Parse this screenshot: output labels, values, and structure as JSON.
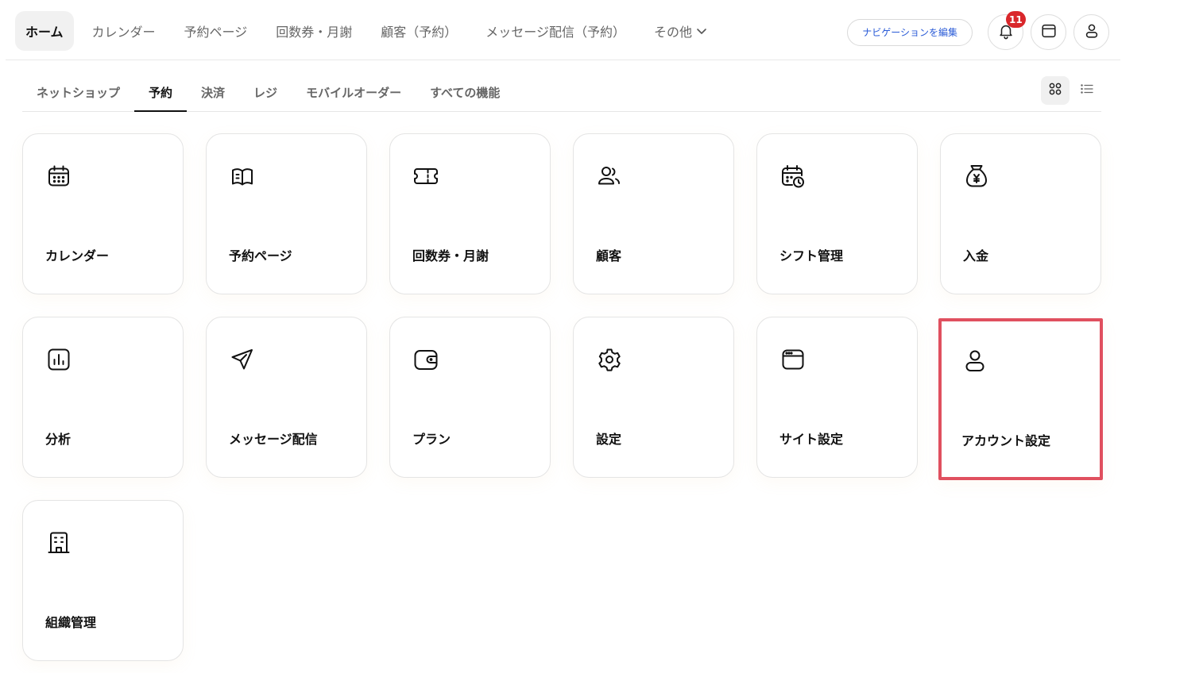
{
  "top_nav": {
    "items": [
      {
        "label": "ホーム"
      },
      {
        "label": "カレンダー"
      },
      {
        "label": "予約ページ"
      },
      {
        "label": "回数券・月謝"
      },
      {
        "label": "顧客（予約）"
      },
      {
        "label": "メッセージ配信（予約）"
      },
      {
        "label": "その他"
      }
    ],
    "edit_nav_label": "ナビゲーションを編集",
    "notification_count": "11"
  },
  "sub_nav": {
    "tabs": [
      {
        "label": "ネットショップ"
      },
      {
        "label": "予約"
      },
      {
        "label": "決済"
      },
      {
        "label": "レジ"
      },
      {
        "label": "モバイルオーダー"
      },
      {
        "label": "すべての機能"
      }
    ]
  },
  "tiles": [
    {
      "label": "カレンダー",
      "icon": "calendar-icon"
    },
    {
      "label": "予約ページ",
      "icon": "open-book-icon"
    },
    {
      "label": "回数券・月謝",
      "icon": "ticket-icon"
    },
    {
      "label": "顧客",
      "icon": "users-icon"
    },
    {
      "label": "シフト管理",
      "icon": "calendar-clock-icon"
    },
    {
      "label": "入金",
      "icon": "money-bag-yen-icon"
    },
    {
      "label": "分析",
      "icon": "bar-chart-icon"
    },
    {
      "label": "メッセージ配信",
      "icon": "send-icon"
    },
    {
      "label": "プラン",
      "icon": "wallet-icon"
    },
    {
      "label": "設定",
      "icon": "gear-icon"
    },
    {
      "label": "サイト設定",
      "icon": "browser-window-icon"
    },
    {
      "label": "アカウント設定",
      "icon": "user-icon"
    },
    {
      "label": "組織管理",
      "icon": "building-icon"
    }
  ],
  "colors": {
    "highlight_border": "#e0505f",
    "badge": "#d9272b",
    "link_blue": "#2a5bd7"
  }
}
